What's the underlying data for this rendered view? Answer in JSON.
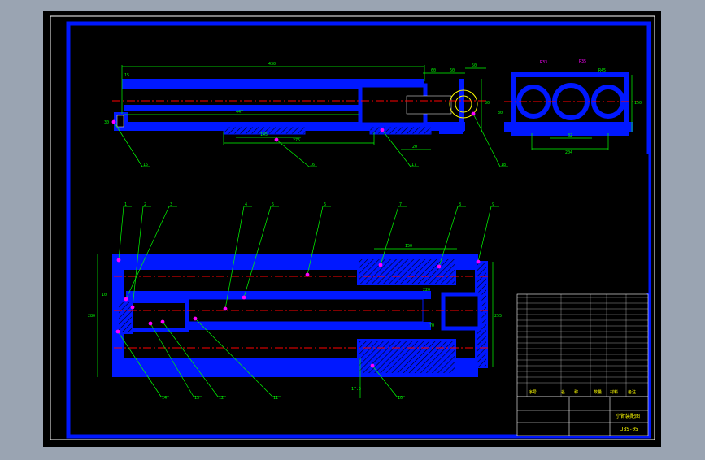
{
  "colors": {
    "background": "#9aa4b2",
    "paper": "#000000",
    "outline": "#0018ff",
    "dimension": "#00ff00",
    "centerline": "#ff0000",
    "leader": "#ff00ff",
    "white": "#ffffff",
    "yellow": "#ffff00"
  },
  "top_view": {
    "dims": [
      "430",
      "15",
      "447",
      "60",
      "60",
      "50",
      "30",
      "275",
      "145",
      "20",
      "30"
    ]
  },
  "side_view": {
    "dims": [
      "R33",
      "R35",
      "R45",
      "150",
      "82",
      "204",
      "30"
    ]
  },
  "section_view": {
    "dims": [
      "150",
      "280",
      "10",
      "255",
      "220",
      "70",
      "17.5"
    ]
  },
  "callouts": {
    "top": [
      "15",
      "16",
      "17",
      "18"
    ],
    "section_top": [
      "1",
      "2",
      "3",
      "4",
      "5",
      "6",
      "7",
      "8",
      "9"
    ],
    "section_bottom": [
      "14",
      "13",
      "12",
      "11",
      "10"
    ]
  },
  "title_block": {
    "drawing_name": "小臂装配图",
    "drawing_number": "JBS-05",
    "header_labels": [
      "序号",
      "名",
      "称",
      "数量",
      "材料",
      "备注"
    ]
  }
}
